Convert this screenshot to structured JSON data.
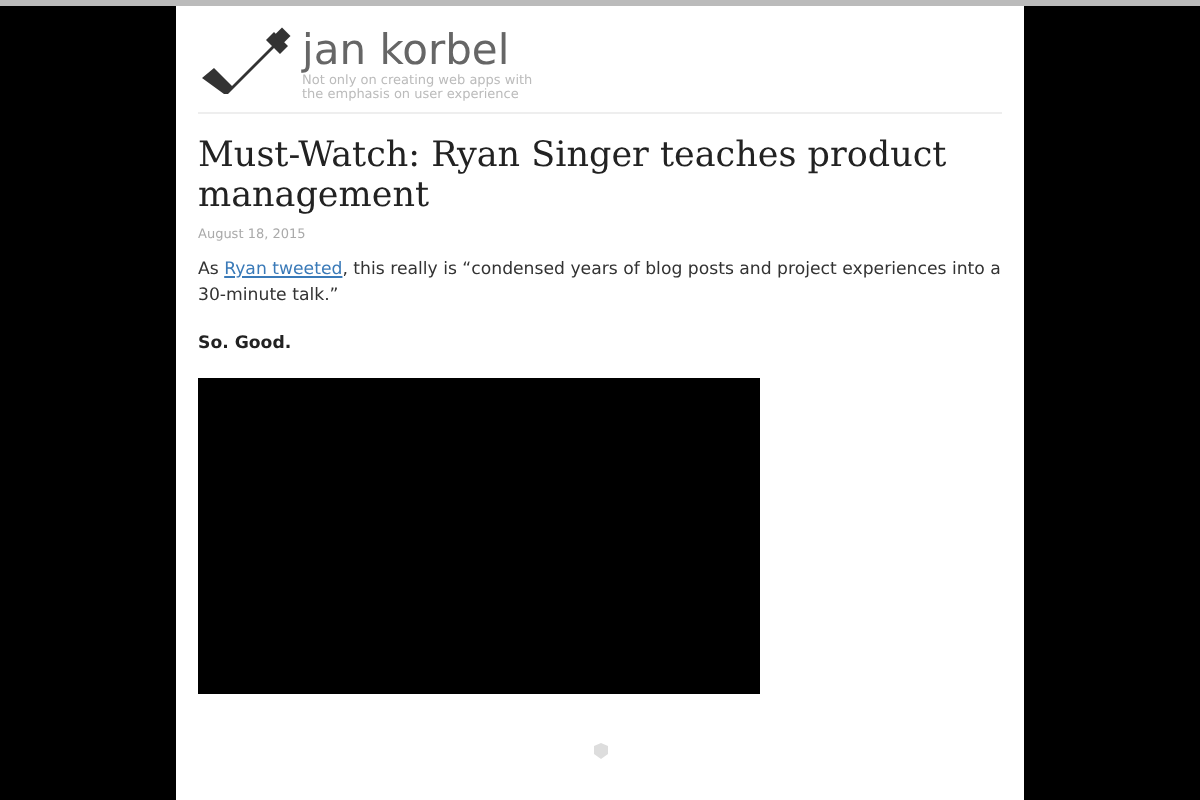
{
  "site": {
    "title": "jan korbel",
    "tagline": "Not only on creating web apps with the emphasis on user experience"
  },
  "post": {
    "title": "Must-Watch: Ryan Singer teaches product management",
    "date": "August 18, 2015",
    "paragraph": [
      {
        "kind": "text",
        "text": "As "
      },
      {
        "kind": "link",
        "text": "Ryan tweeted"
      },
      {
        "kind": "text",
        "text": ", this really is “condensed years of blog posts and project experiences into a 30-minute talk.”"
      }
    ],
    "emphasis": "So. Good.",
    "video": {
      "kind": "video"
    }
  }
}
